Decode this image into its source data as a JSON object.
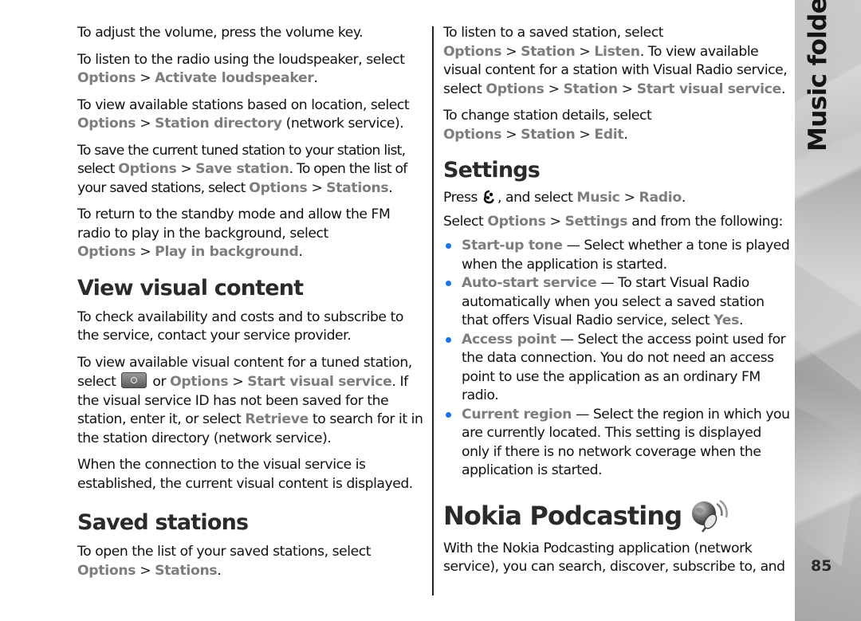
{
  "side_tab": {
    "section_title": "Music folder",
    "page_number": "85"
  },
  "left_column": {
    "p1": "To adjust the volume, press the volume key.",
    "p2": {
      "pre": "To listen to the radio using the loudspeaker, select ",
      "m1": "Options",
      "m2": "Activate loudspeaker",
      "post": "."
    },
    "p3": {
      "pre": "To view available stations based on location, select ",
      "m1": "Options",
      "m2": "Station directory",
      "post": " (network service)."
    },
    "p4": {
      "pre": "To save the current tuned station to your station list, select ",
      "m1": "Options",
      "m2": "Save station",
      "mid": ". To open the list of your saved stations, select ",
      "m3": "Options",
      "m4": "Stations",
      "post": "."
    },
    "p5": {
      "pre": "To return to the standby mode and allow the FM radio to play in the background, select ",
      "m1": "Options",
      "m2": "Play in background",
      "post": "."
    },
    "h_visual": "View visual content",
    "p6": "To check availability and costs and to subscribe to the service, contact your service provider.",
    "p7": {
      "pre": "To view available visual content for a tuned station, select ",
      "mid1": " or ",
      "m1": "Options",
      "m2": "Start visual service",
      "mid2": ". If the visual service ID has not been saved for the station, enter it, or select ",
      "m3": "Retrieve",
      "post": " to search for it in the station directory (network service)."
    },
    "p8": "When the connection to the visual service is established, the current visual content is displayed.",
    "h_saved": "Saved stations",
    "p9": {
      "pre": "To open the list of your saved stations, select ",
      "m1": "Options",
      "m2": "Stations",
      "post": "."
    }
  },
  "right_column": {
    "p1": {
      "pre": "To listen to a saved station, select ",
      "m1": "Options",
      "m2": "Station",
      "m3": "Listen",
      "mid": ". To view available visual content for a station with Visual Radio service, select ",
      "m4": "Options",
      "m5": "Station",
      "m6": "Start visual service",
      "post": "."
    },
    "p2": {
      "pre": "To change station details, select ",
      "m1": "Options",
      "m2": "Station",
      "m3": "Edit",
      "post": "."
    },
    "h_settings": "Settings",
    "p3": {
      "pre": "Press ",
      "mid": ", and select ",
      "m1": "Music",
      "m2": "Radio",
      "post": "."
    },
    "p4": {
      "pre": "Select ",
      "m1": "Options",
      "m2": "Settings",
      "post": " and from the following:"
    },
    "settings_items": [
      {
        "term": "Start-up tone",
        "desc": " — Select whether a tone is played when the application is started."
      },
      {
        "term": "Auto-start service",
        "desc": " — To start Visual Radio automatically when you select a saved station that offers Visual Radio service, select ",
        "m": "Yes",
        "post": "."
      },
      {
        "term": "Access point",
        "desc": " — Select the access point used for the data connection. You do not need an access point to use the application as an ordinary FM radio."
      },
      {
        "term": "Current region",
        "desc": " — Select the region in which you are currently located. This setting is displayed only if there is no network coverage when the application is started."
      }
    ],
    "h_podcasting": "Nokia Podcasting",
    "p5": "With the Nokia Podcasting application (network service), you can search, discover, subscribe to, and"
  },
  "separator": ">",
  "icons": {
    "visual_service_key": "visual-radio-key-icon",
    "menu_key": "menu-key-icon",
    "podcasting": "podcasting-app-icon"
  },
  "colors": {
    "menu_text": "#7d7d7d",
    "bullet": "#1a73e8",
    "body_text": "#111111"
  }
}
